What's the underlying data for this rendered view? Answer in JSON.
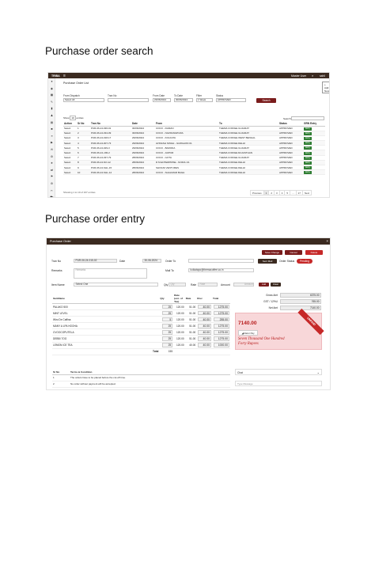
{
  "headings": {
    "search": "Purchase order search",
    "entry": "Purchase order entry"
  },
  "search_screen": {
    "brand": "TRIBA",
    "menu_glyph": "≡",
    "user": "Master User",
    "user_short": "sahil",
    "panel_title": "Purchase Order List",
    "add_new": "Add New",
    "filters": {
      "from_dispatch_label": "From Dispatch",
      "from_dispatch_value": "Select All",
      "tran_no_label": "Tran No",
      "from_date_label": "From Date",
      "from_date_value": "23/06/2024",
      "to_date_label": "To Date",
      "to_date_value": "30/06/2024",
      "filter_label": "Filter",
      "filter_value": "1 Week",
      "status_label": "Status",
      "status_value": "APPROVED",
      "search_button": "Search"
    },
    "show_label": "Show",
    "show_value": "10",
    "entries_label": "entries",
    "search_label": "Search:",
    "columns": [
      "Action",
      "Sr No",
      "Tran No",
      "Date",
      "From",
      "To",
      "Status",
      "GRN Entry"
    ],
    "rows": [
      {
        "action": "Select",
        "sr": "1",
        "tran": "PUR-06-24-036-01",
        "date": "30/06/2024",
        "from": "COCO - DAMAN",
        "to": "THEMA COFFEE GUJARAT",
        "status": "APPROVED",
        "grn": "Entry"
      },
      {
        "action": "Select",
        "sr": "2",
        "tran": "PUR-06-24-034-09",
        "date": "30/06/2024",
        "from": "COCO - NAVRANGPURA",
        "to": "THEMA COFFEE GUJARAT",
        "status": "APPROVED",
        "grn": "Entry"
      },
      {
        "action": "Select",
        "sr": "3",
        "tran": "PUR-06-24-018-17",
        "date": "29/06/2024",
        "from": "COCO - KOLKATA",
        "to": "THEMA COFFEE WEST BENGAL",
        "status": "APPROVED",
        "grn": "Entry"
      },
      {
        "action": "Select",
        "sr": "4",
        "tran": "PUR-06-24-007-73",
        "date": "29/06/2024",
        "from": "AVINASH SINGH - GURGAON 01",
        "to": "THEMA COFFEE DELHI",
        "status": "APPROVED",
        "grn": "Entry"
      },
      {
        "action": "Select",
        "sr": "5",
        "tran": "PUR-06-24-029-3",
        "date": "29/06/2024",
        "from": "COCO - BARODA",
        "to": "THEMA COFFEE GUJARAT",
        "status": "APPROVED",
        "grn": "Entry"
      },
      {
        "action": "Select",
        "sr": "6",
        "tran": "PUR-06-24-JJR-2",
        "date": "29/06/2024",
        "from": "COCO - JAIPUR",
        "to": "THEMA COFFEE RAJASTHAN",
        "status": "APPROVED",
        "grn": "Entry"
      },
      {
        "action": "Select",
        "sr": "7",
        "tran": "PUR-06-24-037-79",
        "date": "28/06/2024",
        "from": "COCO - GOTA",
        "to": "THEMA COFFEE GUJARAT",
        "status": "APPROVED",
        "grn": "Entry"
      },
      {
        "action": "Select",
        "sr": "8",
        "tran": "PUR-06-24-NO-12",
        "date": "28/06/2024",
        "from": "R M ENTERPRISE - NOIDA 1/1",
        "to": "THEMA COFFEE DELHI",
        "status": "APPROVED",
        "grn": "Entry"
      },
      {
        "action": "Select",
        "sr": "9",
        "tran": "PUR-06-24-SHL-15",
        "date": "28/06/2024",
        "from": "SHIVANI VENTURES",
        "to": "THEMA COFFEE DELHI",
        "status": "APPROVED",
        "grn": "Entry"
      },
      {
        "action": "Select",
        "sr": "10",
        "tran": "PUR-06-24-SHL-12",
        "date": "28/06/2024",
        "from": "COCO - SHALIMAR BAGH",
        "to": "THEMA COFFEE DELHI",
        "status": "APPROVED",
        "grn": "Entry"
      }
    ],
    "showing": "Showing 1 to 10 of 167 entries",
    "pager": [
      "Previous",
      "1",
      "2",
      "3",
      "4",
      "5",
      "...",
      "17",
      "Next"
    ]
  },
  "entry_screen": {
    "title": "Purchase Order",
    "close_glyph": "×",
    "buttons": {
      "save_change": "Save Change",
      "cancel": "Cancel",
      "delete": "Delete",
      "sent_mail": "Sent Mail"
    },
    "tran_no_label": "Tran No",
    "tran_no_value": "PUR-06-24-015-02",
    "date_label": "Date",
    "date_value": "30-06-2024",
    "order_to_label": "Order To",
    "order_status_label": "Order Status",
    "order_status_value": "Pending",
    "remarks_label": "Remarks",
    "remarks_placeholder": "Remarks",
    "mail_to_label": "Mail To",
    "mail_to_value": "kolkatapo@themacoffee.co.in",
    "item_name_label": "Item Name",
    "item_select": "Select One",
    "qty_label": "Qty",
    "qty_placeholder": "Qty",
    "rate_label": "Rate",
    "rate_placeholder": "Rate",
    "amount_label": "Amount",
    "amount_placeholder": "Amount",
    "add_btn": "Add",
    "clear_btn": "Clear",
    "item_columns": [
      "ItemName",
      "Qty",
      "Rate (exc. of Tax)",
      "Rate",
      "Disc",
      "Total"
    ],
    "items": [
      {
        "name": "PALAKO 500",
        "qty": "25",
        "rate_ex": "120.00",
        "rate": "51.00",
        "disc": "40.00",
        "total": "1275.00"
      },
      {
        "name": "MINT LEVEL",
        "qty": "25",
        "rate_ex": "120.00",
        "rate": "51.00",
        "disc": "40.00",
        "total": "1275.00"
      },
      {
        "name": "Wiro De Caffina",
        "qty": "5",
        "rate_ex": "120.00",
        "rate": "51.00",
        "disc": "40.00",
        "total": "255.00"
      },
      {
        "name": "MANY A LPA HOOHA",
        "qty": "25",
        "rate_ex": "120.00",
        "rate": "51.00",
        "disc": "40.00",
        "total": "1275.00"
      },
      {
        "name": "CVOOCOPUTELA",
        "qty": "25",
        "rate_ex": "120.00",
        "rate": "51.00",
        "disc": "40.00",
        "total": "1275.00"
      },
      {
        "name": "DEBBI 7OG",
        "qty": "25",
        "rate_ex": "120.00",
        "rate": "51.00",
        "disc": "40.00",
        "total": "1275.00"
      },
      {
        "name": "LEMON ICE TEA",
        "qty": "25",
        "rate_ex": "120.00",
        "rate": "40.00",
        "disc": "40.00",
        "total": "1000.00"
      }
    ],
    "total_label": "Total",
    "total_qty": "155",
    "gross_amt_label": "Gross Amt",
    "gross_amt_value": "6375.00",
    "gst_label": "GST / 12%U",
    "gst_value": "765.00",
    "net_amt_label": "Net Amt",
    "net_amt_value": "7140.00",
    "amount_big": "7140.00",
    "razorpay": "Razor Pay",
    "amount_words": "Seven Thousand One Hundred Forty Rupees",
    "ribbon": "UNPAID",
    "terms_columns": [
      "Sr No",
      "Terms & Condition"
    ],
    "terms": [
      {
        "sr": "1",
        "text": "The orders have to be placed before the cut-off time."
      },
      {
        "sr": "2",
        "text": "No order without payment will be accepted."
      }
    ],
    "chat_label": "Chat",
    "chat_placeholder": "Type Message",
    "colors": {
      "header": "#3b2a20",
      "accent_red": "#c62828",
      "dark_red": "#7a1c1c",
      "green": "#2e7d32"
    }
  }
}
